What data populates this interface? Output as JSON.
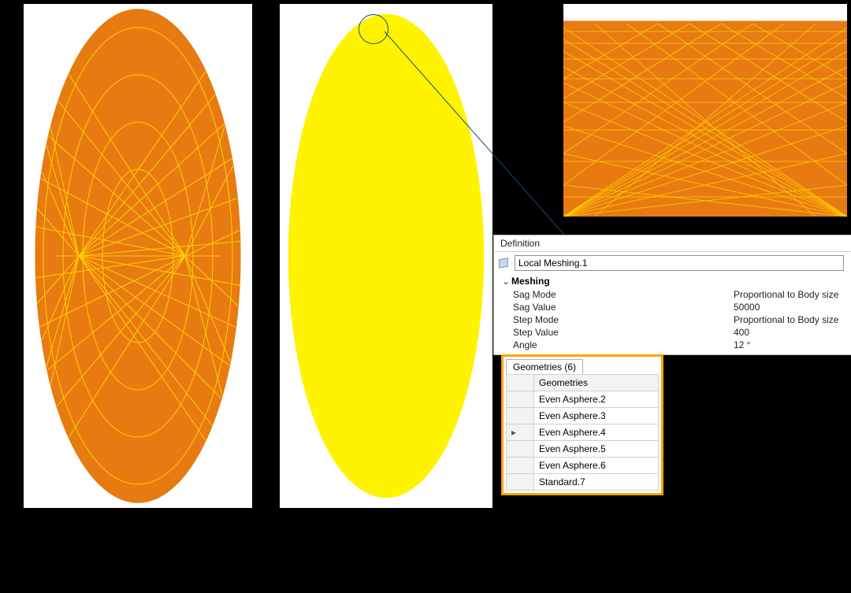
{
  "definition": {
    "section_label": "Definition",
    "icon": "cube-icon",
    "name_value": "Local Meshing.1",
    "group_label": "Meshing",
    "props": [
      {
        "key": "Sag Mode",
        "value": "Proportional to Body size"
      },
      {
        "key": "Sag Value",
        "value": "50000"
      },
      {
        "key": "Step Mode",
        "value": "Proportional to Body size"
      },
      {
        "key": "Step Value",
        "value": "400"
      },
      {
        "key": "Angle",
        "value": "12 °"
      }
    ]
  },
  "geometries": {
    "tab_label": "Geometries (6)",
    "column_header": "Geometries",
    "rows": [
      {
        "marker": "",
        "name": "Even Asphere.2"
      },
      {
        "marker": "",
        "name": "Even Asphere.3"
      },
      {
        "marker": "▸",
        "name": "Even Asphere.4"
      },
      {
        "marker": "",
        "name": "Even Asphere.5"
      },
      {
        "marker": "",
        "name": "Even Asphere.6"
      },
      {
        "marker": "",
        "name": "Standard.7"
      }
    ]
  },
  "views": {
    "left": "coarse-mesh-lens",
    "mid": "fine-mesh-lens-front",
    "top": "fine-mesh-lens-closeup"
  }
}
